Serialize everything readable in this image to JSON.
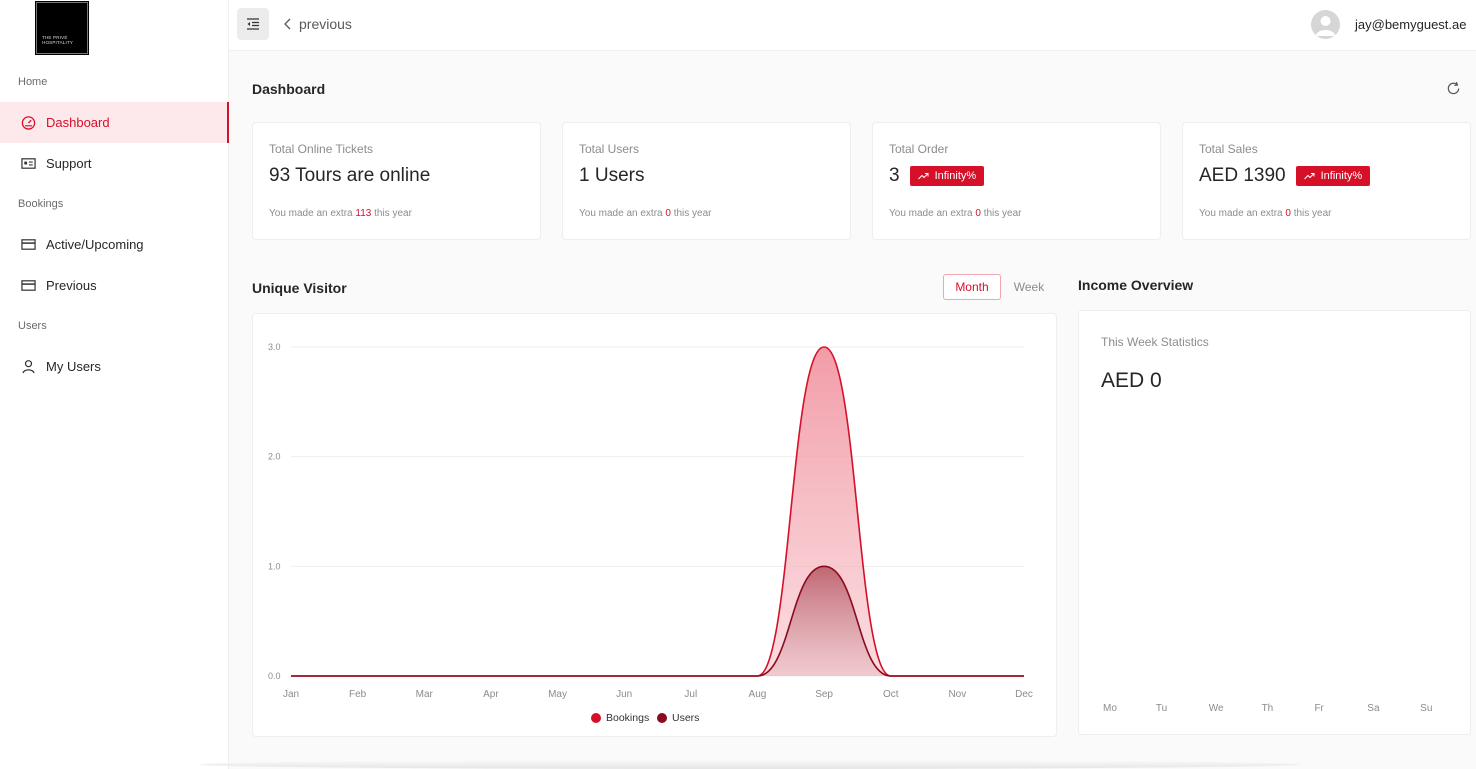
{
  "logo": {
    "text": "THE PRIVÉ HOSPITALITY"
  },
  "sidebar": {
    "groups": [
      {
        "label": "Home"
      },
      {
        "label": "Bookings"
      },
      {
        "label": "Users"
      }
    ],
    "items": [
      {
        "label": "Dashboard",
        "icon": "dashboard-gauge-icon",
        "active": true
      },
      {
        "label": "Support",
        "icon": "id-card-icon"
      },
      {
        "label": "Active/Upcoming",
        "icon": "credit-card-icon"
      },
      {
        "label": "Previous",
        "icon": "credit-card-icon"
      },
      {
        "label": "My Users",
        "icon": "user-icon"
      }
    ]
  },
  "header": {
    "menu_icon": "menu-fold-icon",
    "back_label": "previous",
    "user_email": "jay@bemyguest.ae"
  },
  "dashboard": {
    "title": "Dashboard",
    "cards": [
      {
        "label": "Total Online Tickets",
        "value": "93 Tours are online",
        "badge": "",
        "note_prefix": "You made an extra",
        "note_value": "113",
        "note_suffix": "this year"
      },
      {
        "label": "Total Users",
        "value": "1 Users",
        "badge": "",
        "note_prefix": "You made an extra",
        "note_value": "0",
        "note_suffix": "this year"
      },
      {
        "label": "Total Order",
        "value": "3",
        "badge": "Infinity%",
        "note_prefix": "You made an extra",
        "note_value": "0",
        "note_suffix": "this year"
      },
      {
        "label": "Total Sales",
        "value": "AED 1390",
        "badge": "Infinity%",
        "note_prefix": "You made an extra",
        "note_value": "0",
        "note_suffix": "this year"
      }
    ]
  },
  "visitor": {
    "title": "Unique Visitor",
    "toggle_month": "Month",
    "toggle_week": "Week"
  },
  "income": {
    "title": "Income Overview",
    "subtitle": "This Week Statistics",
    "value": "AED 0",
    "days": [
      "Mo",
      "Tu",
      "We",
      "Th",
      "Fr",
      "Sa",
      "Su"
    ]
  },
  "colors": {
    "accent": "#d7102a",
    "bookings": "#d7102a",
    "users": "#8b0a1f"
  },
  "chart_data": {
    "type": "area",
    "categories": [
      "Jan",
      "Feb",
      "Mar",
      "Apr",
      "May",
      "Jun",
      "Jul",
      "Aug",
      "Sep",
      "Oct",
      "Nov",
      "Dec"
    ],
    "series": [
      {
        "name": "Bookings",
        "values": [
          0,
          0,
          0,
          0,
          0,
          0,
          0,
          0,
          3,
          0,
          0,
          0
        ]
      },
      {
        "name": "Users",
        "values": [
          0,
          0,
          0,
          0,
          0,
          0,
          0,
          0,
          1,
          0,
          0,
          0
        ]
      }
    ],
    "y_ticks": [
      "0.0",
      "1.0",
      "2.0",
      "3.0"
    ],
    "ylim": [
      0,
      3
    ],
    "legend": "bottom",
    "grid": true
  }
}
